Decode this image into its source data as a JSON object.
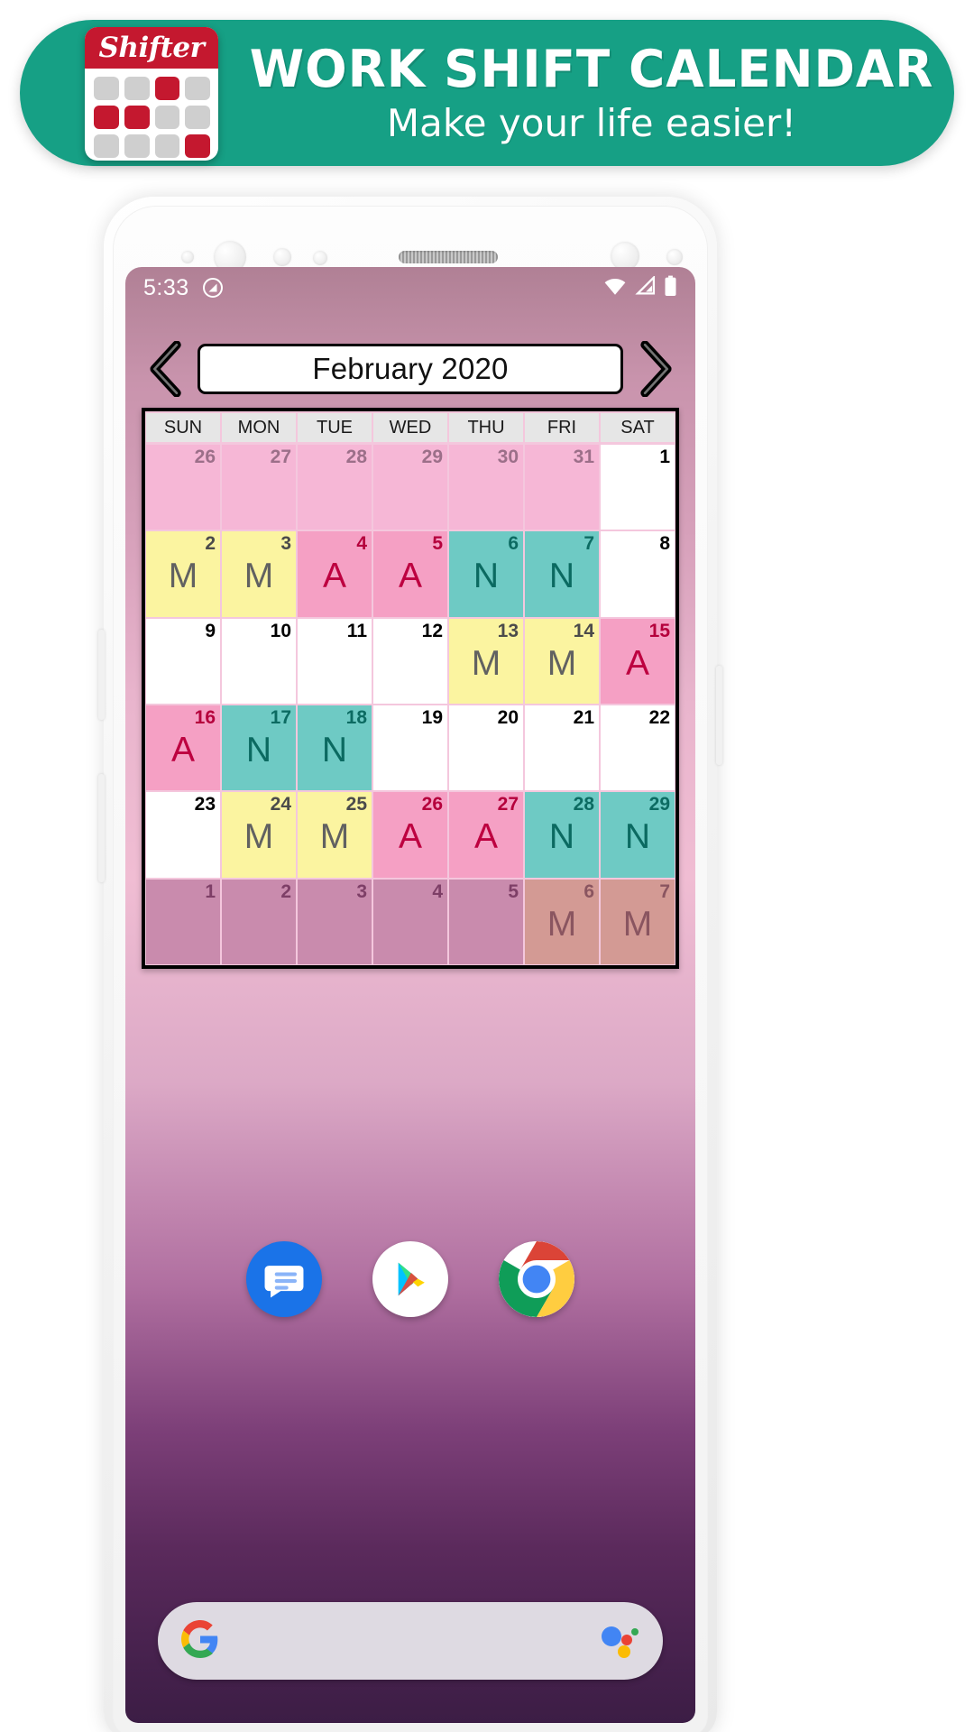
{
  "banner": {
    "logo_word": "Shifter",
    "title": "WORK SHIFT CALENDAR",
    "subtitle": "Make your life easier!",
    "bg_color": "#16a085",
    "logo_red": "#c4182f"
  },
  "status_bar": {
    "time": "5:33",
    "dnd_icon": "do-not-disturb-icon",
    "wifi_icon": "wifi-icon",
    "signal_icon": "cellular-signal-icon",
    "battery_icon": "battery-full-icon"
  },
  "calendar": {
    "prev_label": "‹",
    "next_label": "›",
    "month_label": "February 2020",
    "weekdays": [
      "SUN",
      "MON",
      "TUE",
      "WED",
      "THU",
      "FRI",
      "SAT"
    ],
    "shift_colors": {
      "M": "#fbf4a0",
      "A": "#f5a0c4",
      "N": "#6ecac4",
      "off": "#ffffff",
      "out_of_month": "#f6b7d6"
    },
    "weeks": [
      [
        {
          "num": "26",
          "shift": "",
          "type": "out"
        },
        {
          "num": "27",
          "shift": "",
          "type": "out"
        },
        {
          "num": "28",
          "shift": "",
          "type": "out"
        },
        {
          "num": "29",
          "shift": "",
          "type": "out"
        },
        {
          "num": "30",
          "shift": "",
          "type": "out"
        },
        {
          "num": "31",
          "shift": "",
          "type": "out"
        },
        {
          "num": "1",
          "shift": "",
          "type": "off"
        }
      ],
      [
        {
          "num": "2",
          "shift": "M",
          "type": "m"
        },
        {
          "num": "3",
          "shift": "M",
          "type": "m"
        },
        {
          "num": "4",
          "shift": "A",
          "type": "a"
        },
        {
          "num": "5",
          "shift": "A",
          "type": "a"
        },
        {
          "num": "6",
          "shift": "N",
          "type": "n"
        },
        {
          "num": "7",
          "shift": "N",
          "type": "n"
        },
        {
          "num": "8",
          "shift": "",
          "type": "off"
        }
      ],
      [
        {
          "num": "9",
          "shift": "",
          "type": "off"
        },
        {
          "num": "10",
          "shift": "",
          "type": "off"
        },
        {
          "num": "11",
          "shift": "",
          "type": "off"
        },
        {
          "num": "12",
          "shift": "",
          "type": "off"
        },
        {
          "num": "13",
          "shift": "M",
          "type": "m"
        },
        {
          "num": "14",
          "shift": "M",
          "type": "m"
        },
        {
          "num": "15",
          "shift": "A",
          "type": "a"
        }
      ],
      [
        {
          "num": "16",
          "shift": "A",
          "type": "a"
        },
        {
          "num": "17",
          "shift": "N",
          "type": "n"
        },
        {
          "num": "18",
          "shift": "N",
          "type": "n"
        },
        {
          "num": "19",
          "shift": "",
          "type": "off"
        },
        {
          "num": "20",
          "shift": "",
          "type": "off"
        },
        {
          "num": "21",
          "shift": "",
          "type": "off"
        },
        {
          "num": "22",
          "shift": "",
          "type": "off"
        }
      ],
      [
        {
          "num": "23",
          "shift": "",
          "type": "off"
        },
        {
          "num": "24",
          "shift": "M",
          "type": "m"
        },
        {
          "num": "25",
          "shift": "M",
          "type": "m"
        },
        {
          "num": "26",
          "shift": "A",
          "type": "a"
        },
        {
          "num": "27",
          "shift": "A",
          "type": "a"
        },
        {
          "num": "28",
          "shift": "N",
          "type": "n"
        },
        {
          "num": "29",
          "shift": "N",
          "type": "n"
        }
      ],
      [
        {
          "num": "1",
          "shift": "",
          "type": "dim"
        },
        {
          "num": "2",
          "shift": "",
          "type": "dim"
        },
        {
          "num": "3",
          "shift": "",
          "type": "dim"
        },
        {
          "num": "4",
          "shift": "",
          "type": "dim"
        },
        {
          "num": "5",
          "shift": "",
          "type": "dim"
        },
        {
          "num": "6",
          "shift": "M",
          "type": "dim m"
        },
        {
          "num": "7",
          "shift": "M",
          "type": "dim m"
        }
      ]
    ]
  },
  "dock": {
    "apps": [
      {
        "name": "messages-app-icon",
        "label": "Messages"
      },
      {
        "name": "play-store-app-icon",
        "label": "Play Store"
      },
      {
        "name": "chrome-app-icon",
        "label": "Chrome"
      }
    ]
  },
  "search": {
    "google_icon": "google-g-icon",
    "assistant_icon": "google-assistant-icon",
    "placeholder": ""
  }
}
